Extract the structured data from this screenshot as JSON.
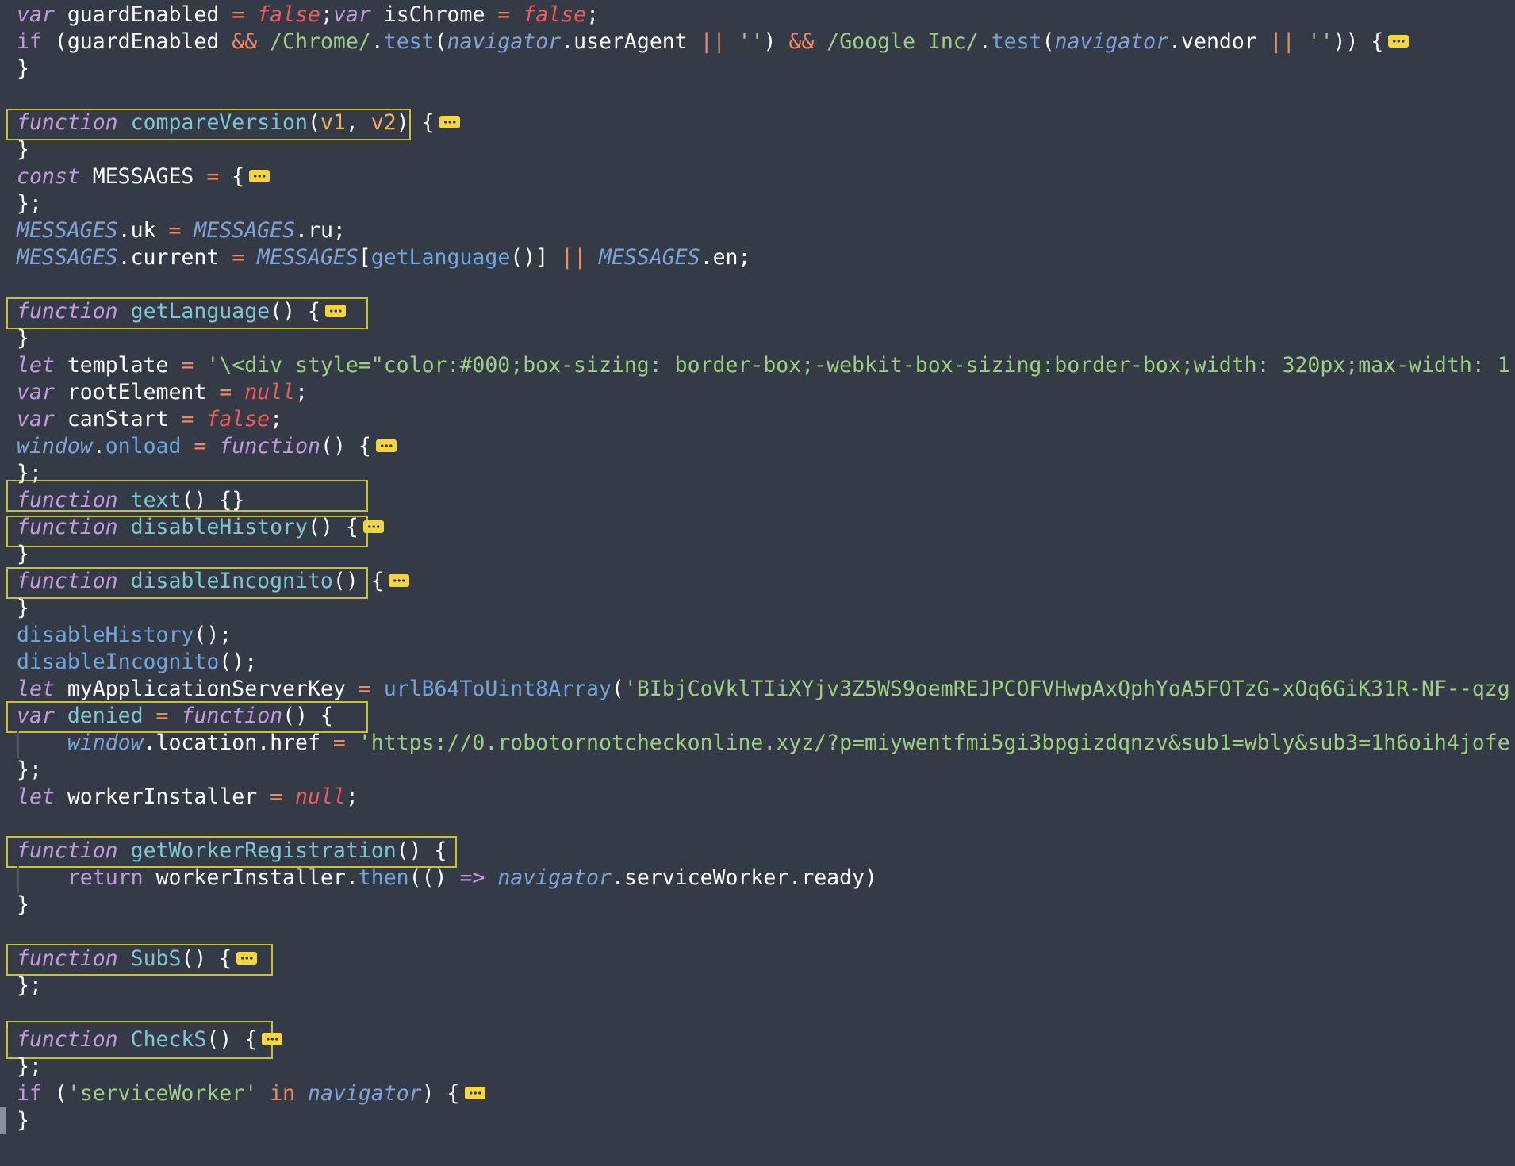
{
  "editor": {
    "lines": [
      {
        "tokens": [
          [
            "kw",
            "var"
          ],
          [
            "plain",
            " guardEnabled "
          ],
          [
            "op",
            "="
          ],
          [
            "plain",
            " "
          ],
          [
            "bool",
            "false"
          ],
          [
            "plain",
            ";"
          ],
          [
            "kw",
            "var"
          ],
          [
            "plain",
            " isChrome "
          ],
          [
            "op",
            "="
          ],
          [
            "plain",
            " "
          ],
          [
            "bool",
            "false"
          ],
          [
            "plain",
            ";"
          ]
        ]
      },
      {
        "tokens": [
          [
            "ctl",
            "if"
          ],
          [
            "plain",
            " (guardEnabled "
          ],
          [
            "op",
            "&&"
          ],
          [
            "plain",
            " "
          ],
          [
            "str",
            "/Chrome/"
          ],
          [
            "plain",
            "."
          ],
          [
            "meth",
            "test"
          ],
          [
            "plain",
            "("
          ],
          [
            "glob",
            "navigator"
          ],
          [
            "plain",
            ".userAgent "
          ],
          [
            "op",
            "||"
          ],
          [
            "plain",
            " "
          ],
          [
            "str",
            "''"
          ],
          [
            "plain",
            ") "
          ],
          [
            "op",
            "&&"
          ],
          [
            "plain",
            " "
          ],
          [
            "str",
            "/Google Inc/"
          ],
          [
            "plain",
            "."
          ],
          [
            "meth",
            "test"
          ],
          [
            "plain",
            "("
          ],
          [
            "glob",
            "navigator"
          ],
          [
            "plain",
            ".vendor "
          ],
          [
            "op",
            "||"
          ],
          [
            "plain",
            " "
          ],
          [
            "str",
            "''"
          ],
          [
            "plain",
            ")) {"
          ]
        ],
        "fold": true
      },
      {
        "tokens": [
          [
            "plain",
            "}"
          ]
        ]
      },
      {
        "tokens": []
      },
      {
        "tokens": [
          [
            "kw",
            "function"
          ],
          [
            "plain",
            " "
          ],
          [
            "fn",
            "compareVersion"
          ],
          [
            "plain",
            "("
          ],
          [
            "param",
            "v1"
          ],
          [
            "plain",
            ", "
          ],
          [
            "param",
            "v2"
          ],
          [
            "plain",
            ") {"
          ]
        ],
        "fold": true
      },
      {
        "tokens": [
          [
            "plain",
            "}"
          ]
        ]
      },
      {
        "tokens": [
          [
            "kw",
            "const"
          ],
          [
            "plain",
            " MESSAGES "
          ],
          [
            "op",
            "="
          ],
          [
            "plain",
            " {"
          ]
        ],
        "fold": true
      },
      {
        "tokens": [
          [
            "plain",
            "};"
          ]
        ]
      },
      {
        "tokens": [
          [
            "glob",
            "MESSAGES"
          ],
          [
            "plain",
            ".uk "
          ],
          [
            "op",
            "="
          ],
          [
            "plain",
            " "
          ],
          [
            "glob",
            "MESSAGES"
          ],
          [
            "plain",
            ".ru;"
          ]
        ]
      },
      {
        "tokens": [
          [
            "glob",
            "MESSAGES"
          ],
          [
            "plain",
            ".current "
          ],
          [
            "op",
            "="
          ],
          [
            "plain",
            " "
          ],
          [
            "glob",
            "MESSAGES"
          ],
          [
            "plain",
            "["
          ],
          [
            "meth",
            "getLanguage"
          ],
          [
            "plain",
            "()] "
          ],
          [
            "op",
            "||"
          ],
          [
            "plain",
            " "
          ],
          [
            "glob",
            "MESSAGES"
          ],
          [
            "plain",
            ".en;"
          ]
        ]
      },
      {
        "tokens": []
      },
      {
        "tokens": [
          [
            "kw",
            "function"
          ],
          [
            "plain",
            " "
          ],
          [
            "fn",
            "getLanguage"
          ],
          [
            "plain",
            "() {"
          ]
        ],
        "fold": true
      },
      {
        "tokens": [
          [
            "plain",
            "}"
          ]
        ]
      },
      {
        "tokens": [
          [
            "kw",
            "let"
          ],
          [
            "plain",
            " template "
          ],
          [
            "op",
            "="
          ],
          [
            "plain",
            " "
          ],
          [
            "str",
            "'\\<div style=\"color:#000;box-sizing: border-box;-webkit-box-sizing:border-box;width: 320px;max-width: 1"
          ]
        ]
      },
      {
        "tokens": [
          [
            "kw",
            "var"
          ],
          [
            "plain",
            " rootElement "
          ],
          [
            "op",
            "="
          ],
          [
            "plain",
            " "
          ],
          [
            "bool",
            "null"
          ],
          [
            "plain",
            ";"
          ]
        ]
      },
      {
        "tokens": [
          [
            "kw",
            "var"
          ],
          [
            "plain",
            " canStart "
          ],
          [
            "op",
            "="
          ],
          [
            "plain",
            " "
          ],
          [
            "bool",
            "false"
          ],
          [
            "plain",
            ";"
          ]
        ]
      },
      {
        "tokens": [
          [
            "glob",
            "window"
          ],
          [
            "plain",
            "."
          ],
          [
            "meth",
            "onload"
          ],
          [
            "plain",
            " "
          ],
          [
            "op",
            "="
          ],
          [
            "plain",
            " "
          ],
          [
            "kw",
            "function"
          ],
          [
            "plain",
            "() {"
          ]
        ],
        "fold": true
      },
      {
        "tokens": [
          [
            "plain",
            "};"
          ]
        ]
      },
      {
        "tokens": [
          [
            "kw",
            "function"
          ],
          [
            "plain",
            " "
          ],
          [
            "fn",
            "text"
          ],
          [
            "plain",
            "() {}"
          ]
        ]
      },
      {
        "tokens": [
          [
            "kw",
            "function"
          ],
          [
            "plain",
            " "
          ],
          [
            "fn",
            "disableHistory"
          ],
          [
            "plain",
            "() {"
          ]
        ],
        "fold": true
      },
      {
        "tokens": [
          [
            "plain",
            "}"
          ]
        ]
      },
      {
        "tokens": [
          [
            "kw",
            "function"
          ],
          [
            "plain",
            " "
          ],
          [
            "fn",
            "disableIncognito"
          ],
          [
            "plain",
            "() {"
          ]
        ],
        "fold": true
      },
      {
        "tokens": [
          [
            "plain",
            "}"
          ]
        ]
      },
      {
        "tokens": [
          [
            "meth",
            "disableHistory"
          ],
          [
            "plain",
            "();"
          ]
        ]
      },
      {
        "tokens": [
          [
            "meth",
            "disableIncognito"
          ],
          [
            "plain",
            "();"
          ]
        ]
      },
      {
        "tokens": [
          [
            "kw",
            "let"
          ],
          [
            "plain",
            " myApplicationServerKey "
          ],
          [
            "op",
            "="
          ],
          [
            "plain",
            " "
          ],
          [
            "meth",
            "urlB64ToUint8Array"
          ],
          [
            "plain",
            "("
          ],
          [
            "str",
            "'BIbjCoVklTIiXYjv3Z5WS9oemREJPCOFVHwpAxQphYoA5FOTzG-xOq6GiK31R-NF--qzg"
          ]
        ]
      },
      {
        "tokens": [
          [
            "kw",
            "var"
          ],
          [
            "plain",
            " "
          ],
          [
            "fn",
            "denied"
          ],
          [
            "plain",
            " "
          ],
          [
            "op",
            "="
          ],
          [
            "plain",
            " "
          ],
          [
            "kw",
            "function"
          ],
          [
            "plain",
            "() {"
          ]
        ]
      },
      {
        "tokens": [
          [
            "plain",
            "    "
          ],
          [
            "glob",
            "window"
          ],
          [
            "plain",
            ".location.href "
          ],
          [
            "op",
            "="
          ],
          [
            "plain",
            " "
          ],
          [
            "str",
            "'https://0.robotornotcheckonline.xyz/?p=miywentfmi5gi3bpgizdqnzv&sub1=wbly&sub3=1h6oih4jofe"
          ]
        ]
      },
      {
        "tokens": [
          [
            "plain",
            "};"
          ]
        ]
      },
      {
        "tokens": [
          [
            "kw",
            "let"
          ],
          [
            "plain",
            " workerInstaller "
          ],
          [
            "op",
            "="
          ],
          [
            "plain",
            " "
          ],
          [
            "bool",
            "null"
          ],
          [
            "plain",
            ";"
          ]
        ]
      },
      {
        "tokens": []
      },
      {
        "tokens": [
          [
            "kw",
            "function"
          ],
          [
            "plain",
            " "
          ],
          [
            "fn",
            "getWorkerRegistration"
          ],
          [
            "plain",
            "() {"
          ]
        ]
      },
      {
        "tokens": [
          [
            "plain",
            "    "
          ],
          [
            "ctl",
            "return"
          ],
          [
            "plain",
            " workerInstaller."
          ],
          [
            "meth",
            "then"
          ],
          [
            "plain",
            "(() "
          ],
          [
            "ctl",
            "=>"
          ],
          [
            "plain",
            " "
          ],
          [
            "glob",
            "navigator"
          ],
          [
            "plain",
            ".serviceWorker.ready)"
          ]
        ]
      },
      {
        "tokens": [
          [
            "plain",
            "}"
          ]
        ]
      },
      {
        "tokens": []
      },
      {
        "tokens": [
          [
            "kw",
            "function"
          ],
          [
            "plain",
            " "
          ],
          [
            "fn",
            "SubS"
          ],
          [
            "plain",
            "() {"
          ]
        ],
        "fold": true
      },
      {
        "tokens": [
          [
            "plain",
            "};"
          ]
        ]
      },
      {
        "tokens": []
      },
      {
        "tokens": [
          [
            "kw",
            "function"
          ],
          [
            "plain",
            " "
          ],
          [
            "fn",
            "CheckS"
          ],
          [
            "plain",
            "() {"
          ]
        ],
        "fold": true
      },
      {
        "tokens": [
          [
            "plain",
            "};"
          ]
        ]
      },
      {
        "tokens": [
          [
            "ctl",
            "if"
          ],
          [
            "plain",
            " ("
          ],
          [
            "str",
            "'serviceWorker'"
          ],
          [
            "plain",
            " "
          ],
          [
            "op",
            "in"
          ],
          [
            "plain",
            " "
          ],
          [
            "glob",
            "navigator"
          ],
          [
            "plain",
            ") {"
          ]
        ],
        "fold": true
      },
      {
        "tokens": [
          [
            "plain",
            "}"
          ]
        ]
      }
    ]
  }
}
